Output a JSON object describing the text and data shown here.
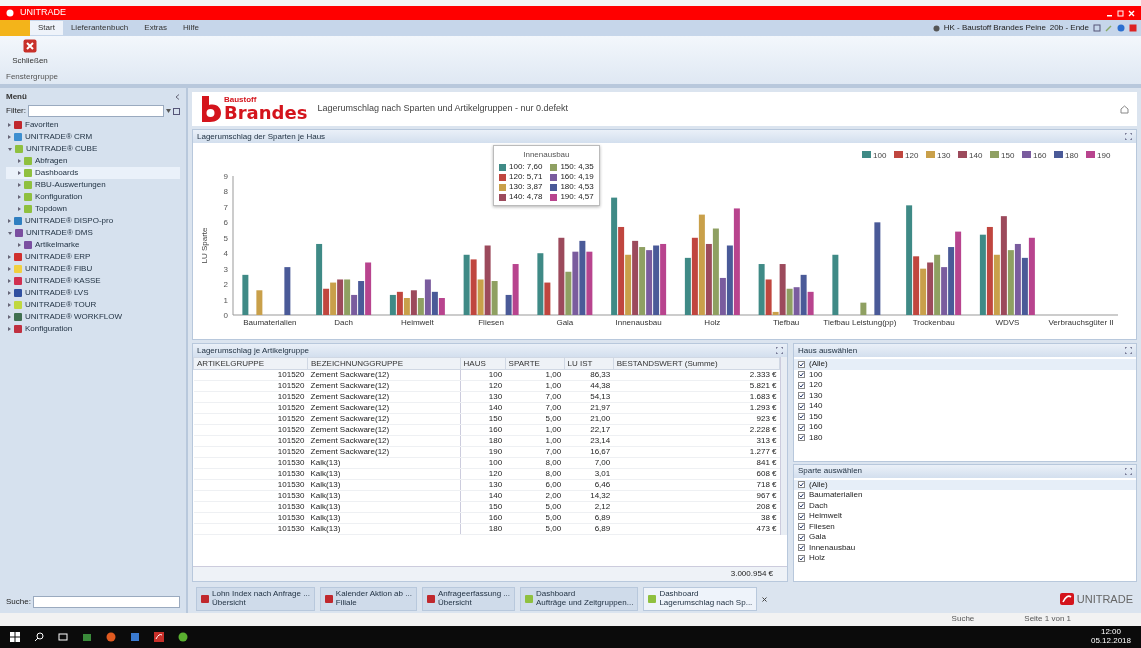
{
  "window": {
    "title": "UNITRADE"
  },
  "ribbon": {
    "tabs": [
      {
        "label": "Start",
        "selected": true
      },
      {
        "label": "Lieferantenbuch",
        "selected": false
      },
      {
        "label": "Extras",
        "selected": false
      },
      {
        "label": "Hilfe",
        "selected": false
      }
    ],
    "buttons": [
      {
        "label": "Schließen"
      }
    ],
    "group_label": "Fenstergruppe",
    "user_info": "HK - Baustoff Brandes Peine",
    "session": "20b - Ende"
  },
  "sidebar": {
    "title": "Menü",
    "filter_label": "Filter:",
    "search_label": "Suche:",
    "items": [
      {
        "label": "Favoriten",
        "color": "#c0282d",
        "expanded": false,
        "selected": false
      },
      {
        "label": "UNITRADE® CRM",
        "color": "#3d8fd0",
        "expanded": false,
        "selected": false
      },
      {
        "label": "UNITRADE® CUBE",
        "color": "#8fc03f",
        "expanded": true,
        "selected": false,
        "children": [
          {
            "label": "Abfragen",
            "color": "#8fc03f",
            "expanded": false,
            "selected": false
          },
          {
            "label": "Dashboards",
            "color": "#8fc03f",
            "expanded": false,
            "selected": true
          },
          {
            "label": "RBU-Auswertungen",
            "color": "#8fc03f",
            "expanded": false,
            "selected": false
          },
          {
            "label": "Konfiguration",
            "color": "#8fc03f",
            "expanded": false,
            "selected": false
          },
          {
            "label": "Topdown",
            "color": "#8fc03f",
            "expanded": false,
            "selected": false
          }
        ]
      },
      {
        "label": "UNITRADE® DISPO-pro",
        "color": "#2f7fc0",
        "expanded": false,
        "selected": false
      },
      {
        "label": "UNITRADE® DMS",
        "color": "#7a4fa0",
        "expanded": true,
        "selected": false,
        "children": [
          {
            "label": "Artikelmarke",
            "color": "#7a4fa0",
            "expanded": false,
            "selected": false
          }
        ]
      },
      {
        "label": "UNITRADE® ERP",
        "color": "#d0302d",
        "expanded": false,
        "selected": false
      },
      {
        "label": "UNITRADE® FIBU",
        "color": "#f0d040",
        "expanded": false,
        "selected": false
      },
      {
        "label": "UNITRADE® KASSE",
        "color": "#d03050",
        "expanded": false,
        "selected": false
      },
      {
        "label": "UNITRADE® LVS",
        "color": "#3050a0",
        "expanded": false,
        "selected": false
      },
      {
        "label": "UNITRADE® TOUR",
        "color": "#c0d840",
        "expanded": false,
        "selected": false
      },
      {
        "label": "UNITRADE® WORKFLOW",
        "color": "#407050",
        "expanded": false,
        "selected": false
      },
      {
        "label": "Konfiguration",
        "color": "#c03040",
        "expanded": false,
        "selected": false
      }
    ]
  },
  "report": {
    "logo_top": "Baustoff",
    "logo_bottom": "Brandes",
    "title": "Lagerumschlag nach Sparten und Artikelgruppen - nur 0.defekt"
  },
  "chart_panel": {
    "title": "Lagerumschlag der Sparten je Haus",
    "chart_data": {
      "type": "bar",
      "legend": "top-right",
      "ylabel": "LU Sparte",
      "ylim": [
        0,
        9
      ],
      "yticks": [
        0,
        1,
        2,
        3,
        4,
        5,
        6,
        7,
        8,
        9
      ],
      "categories": [
        "Baumaterialien",
        "Dach",
        "Heimwelt",
        "Fliesen",
        "Gala",
        "Innenausbau",
        "Holz",
        "Tiefbau",
        "Tiefbau Leistung(pp)",
        "Trockenbau",
        "WDVS",
        "Verbrauchsgüter II"
      ],
      "series": [
        {
          "name": "100",
          "color": "#3f8a86",
          "values": [
            2.6,
            4.6,
            1.3,
            3.9,
            4.0,
            7.6,
            3.7,
            3.3,
            3.9,
            7.1,
            5.2,
            null
          ]
        },
        {
          "name": "120",
          "color": "#c0463f",
          "values": [
            null,
            1.7,
            1.5,
            3.6,
            2.1,
            5.7,
            5.0,
            2.3,
            null,
            3.8,
            5.7,
            null
          ]
        },
        {
          "name": "130",
          "color": "#c9a04a",
          "values": [
            1.6,
            2.1,
            1.1,
            2.3,
            null,
            3.9,
            6.5,
            0.2,
            null,
            3.0,
            3.9,
            null
          ]
        },
        {
          "name": "140",
          "color": "#9c4a5c",
          "values": [
            null,
            2.3,
            1.6,
            4.5,
            5.0,
            4.8,
            4.6,
            3.3,
            null,
            3.4,
            6.4,
            null
          ]
        },
        {
          "name": "150",
          "color": "#8fa062",
          "values": [
            null,
            2.3,
            1.1,
            2.2,
            2.8,
            4.4,
            5.6,
            1.7,
            0.8,
            3.9,
            4.2,
            null
          ]
        },
        {
          "name": "160",
          "color": "#7a5c9e",
          "values": [
            null,
            1.3,
            2.3,
            null,
            4.1,
            4.2,
            2.4,
            1.8,
            null,
            3.1,
            4.6,
            null
          ]
        },
        {
          "name": "180",
          "color": "#4a5a98",
          "values": [
            3.1,
            2.2,
            1.5,
            1.3,
            4.8,
            4.5,
            4.5,
            2.6,
            6.0,
            4.4,
            3.7,
            null
          ]
        },
        {
          "name": "190",
          "color": "#b8448e",
          "values": [
            null,
            3.4,
            1.1,
            3.3,
            4.1,
            4.6,
            6.9,
            1.5,
            null,
            5.4,
            5.0,
            null
          ]
        }
      ]
    },
    "tooltip": {
      "title": "Innenausbau",
      "lines": [
        {
          "label": "100: 7,60",
          "color": "#3f8a86"
        },
        {
          "label": "120: 5,71",
          "color": "#c0463f"
        },
        {
          "label": "130: 3,87",
          "color": "#c9a04a"
        },
        {
          "label": "140: 4,78",
          "color": "#9c4a5c"
        },
        {
          "label": "150: 4,35",
          "color": "#8fa062"
        },
        {
          "label": "160: 4,19",
          "color": "#7a5c9e"
        },
        {
          "label": "180: 4,53",
          "color": "#4a5a98"
        },
        {
          "label": "190: 4,57",
          "color": "#b8448e"
        }
      ]
    }
  },
  "table_panel": {
    "title": "Lagerumschlag je Artikelgruppe",
    "columns": [
      "ARTIKELGRUPPE",
      "BEZEICHNUNGGRUPPE",
      "HAUS",
      "SPARTE",
      "LU IST",
      "BESTANDSWERT (Summe)"
    ],
    "rows": [
      [
        "101520",
        "Zement Sackware(12)",
        "100",
        "1,00",
        "86,33",
        "2.333 €"
      ],
      [
        "101520",
        "Zement Sackware(12)",
        "120",
        "1,00",
        "44,38",
        "5.821 €"
      ],
      [
        "101520",
        "Zement Sackware(12)",
        "130",
        "7,00",
        "54,13",
        "1.683 €"
      ],
      [
        "101520",
        "Zement Sackware(12)",
        "140",
        "7,00",
        "21,97",
        "1.293 €"
      ],
      [
        "101520",
        "Zement Sackware(12)",
        "150",
        "5,00",
        "21,00",
        "923 €"
      ],
      [
        "101520",
        "Zement Sackware(12)",
        "160",
        "1,00",
        "22,17",
        "2.228 €"
      ],
      [
        "101520",
        "Zement Sackware(12)",
        "180",
        "1,00",
        "23,14",
        "313 €"
      ],
      [
        "101520",
        "Zement Sackware(12)",
        "190",
        "7,00",
        "16,67",
        "1.277 €"
      ],
      [
        "101530",
        "Kalk(13)",
        "100",
        "8,00",
        "7,00",
        "841 €"
      ],
      [
        "101530",
        "Kalk(13)",
        "120",
        "8,00",
        "3,01",
        "608 €"
      ],
      [
        "101530",
        "Kalk(13)",
        "130",
        "6,00",
        "6,46",
        "718 €"
      ],
      [
        "101530",
        "Kalk(13)",
        "140",
        "2,00",
        "14,32",
        "967 €"
      ],
      [
        "101530",
        "Kalk(13)",
        "150",
        "5,00",
        "2,12",
        "208 €"
      ],
      [
        "101530",
        "Kalk(13)",
        "160",
        "5,00",
        "6,89",
        "38 €"
      ],
      [
        "101530",
        "Kalk(13)",
        "180",
        "5,00",
        "6,89",
        "473 €"
      ]
    ],
    "total": "3.000.954 €"
  },
  "house_panel": {
    "title": "Haus auswählen",
    "items": [
      {
        "label": "(Alle)",
        "checked": true,
        "selected": true
      },
      {
        "label": "100",
        "checked": true,
        "selected": false
      },
      {
        "label": "120",
        "checked": true,
        "selected": false
      },
      {
        "label": "130",
        "checked": true,
        "selected": false
      },
      {
        "label": "140",
        "checked": true,
        "selected": false
      },
      {
        "label": "150",
        "checked": true,
        "selected": false
      },
      {
        "label": "160",
        "checked": true,
        "selected": false
      },
      {
        "label": "180",
        "checked": true,
        "selected": false
      }
    ]
  },
  "sparte_panel": {
    "title": "Sparte auswählen",
    "items": [
      {
        "label": "(Alle)",
        "checked": true,
        "selected": true
      },
      {
        "label": "Baumaterialien",
        "checked": true,
        "selected": false
      },
      {
        "label": "Dach",
        "checked": true,
        "selected": false
      },
      {
        "label": "Heimwelt",
        "checked": true,
        "selected": false
      },
      {
        "label": "Fliesen",
        "checked": true,
        "selected": false
      },
      {
        "label": "Gala",
        "checked": true,
        "selected": false
      },
      {
        "label": "Innenausbau",
        "checked": true,
        "selected": false
      },
      {
        "label": "Holz",
        "checked": true,
        "selected": false
      }
    ]
  },
  "document_tabs": [
    {
      "line_1": "Lohn Index nach Anfrage ...",
      "line_2": "Übersicht",
      "color": "#c0282d",
      "selected": false
    },
    {
      "line_1": "Kalender Aktion ab ...",
      "line_2": "Filiale",
      "color": "#c0282d",
      "selected": false
    },
    {
      "line_1": "Anfrageerfassung ...",
      "line_2": "Übersicht",
      "color": "#c0282d",
      "selected": false
    },
    {
      "line_1": "Dashboard",
      "line_2": "Aufträge und Zeitgruppen...",
      "color": "#8fc03f",
      "selected": false
    },
    {
      "line_1": "Dashboard",
      "line_2": "Lagerumschlag nach Sp...",
      "color": "#8fc03f",
      "selected": true
    }
  ],
  "brand": "UNITRADE",
  "status_bar": [
    "Suche",
    "Seite 1 von 1"
  ],
  "taskbar": {
    "time": "12:00",
    "date": "05.12.2018"
  }
}
